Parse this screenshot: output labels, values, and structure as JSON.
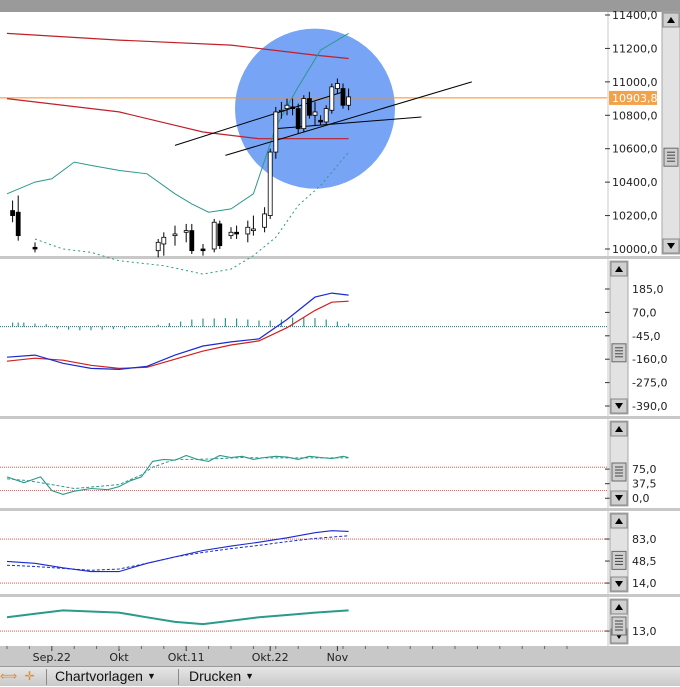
{
  "colors": {
    "price_line": "#ff8c1a",
    "price_tag": "#f4a24a",
    "ma_red": "#c0202a",
    "bollinger": "#2a9a8a",
    "highlight_circle": "#4a86f0",
    "macd_blue": "#1a2ad0",
    "signal_red": "#d02020",
    "histogram": "#2a9a8a",
    "ref_line": "#d04040",
    "dotted_teal": "#2a9a8a"
  },
  "toolbar": {
    "icons": [
      "pan-icon",
      "crosshair-icon"
    ],
    "chartvorlagen_label": "Chartvorlagen",
    "drucken_label": "Drucken",
    "dropdown_icon": "triangle-down-icon"
  },
  "chart_data": [
    {
      "type": "candlestick",
      "panel": "price",
      "y_ticks": [
        "11400,0",
        "11200,0",
        "11000,0",
        "10800,0",
        "10600,0",
        "10400,0",
        "10200,0",
        "10000,0"
      ],
      "ylim": [
        10000,
        11400
      ],
      "current_price_label": "10903,8",
      "current_price": 10903.8,
      "candles": [
        {
          "t": 1,
          "o": 10230,
          "h": 10290,
          "l": 10160,
          "c": 10200
        },
        {
          "t": 2,
          "o": 10220,
          "h": 10320,
          "l": 10050,
          "c": 10080
        },
        {
          "t": 5,
          "o": 10010,
          "h": 10040,
          "l": 9980,
          "c": 10000
        },
        {
          "t": 27,
          "o": 9990,
          "h": 10060,
          "l": 9950,
          "c": 10040
        },
        {
          "t": 28,
          "o": 10030,
          "h": 10100,
          "l": 9960,
          "c": 10070
        },
        {
          "t": 30,
          "o": 10080,
          "h": 10140,
          "l": 10020,
          "c": 10090
        },
        {
          "t": 32,
          "o": 10100,
          "h": 10150,
          "l": 10040,
          "c": 10110
        },
        {
          "t": 33,
          "o": 10110,
          "h": 10150,
          "l": 9970,
          "c": 9990
        },
        {
          "t": 35,
          "o": 10000,
          "h": 10030,
          "l": 9960,
          "c": 9990
        },
        {
          "t": 37,
          "o": 10000,
          "h": 10180,
          "l": 9980,
          "c": 10160
        },
        {
          "t": 38,
          "o": 10150,
          "h": 10170,
          "l": 10000,
          "c": 10020
        },
        {
          "t": 40,
          "o": 10080,
          "h": 10130,
          "l": 10060,
          "c": 10100
        },
        {
          "t": 41,
          "o": 10100,
          "h": 10140,
          "l": 10060,
          "c": 10090
        },
        {
          "t": 43,
          "o": 10090,
          "h": 10170,
          "l": 10040,
          "c": 10130
        },
        {
          "t": 44,
          "o": 10110,
          "h": 10200,
          "l": 10080,
          "c": 10120
        },
        {
          "t": 46,
          "o": 10130,
          "h": 10250,
          "l": 10100,
          "c": 10210
        },
        {
          "t": 47,
          "o": 10200,
          "h": 10600,
          "l": 10180,
          "c": 10580
        },
        {
          "t": 48,
          "o": 10580,
          "h": 10850,
          "l": 10540,
          "c": 10820
        },
        {
          "t": 49,
          "o": 10830,
          "h": 10880,
          "l": 10780,
          "c": 10830
        },
        {
          "t": 50,
          "o": 10840,
          "h": 10900,
          "l": 10800,
          "c": 10860
        },
        {
          "t": 51,
          "o": 10850,
          "h": 10900,
          "l": 10800,
          "c": 10840
        },
        {
          "t": 52,
          "o": 10840,
          "h": 10870,
          "l": 10690,
          "c": 10720
        },
        {
          "t": 53,
          "o": 10720,
          "h": 10920,
          "l": 10700,
          "c": 10900
        },
        {
          "t": 54,
          "o": 10900,
          "h": 10940,
          "l": 10780,
          "c": 10800
        },
        {
          "t": 55,
          "o": 10800,
          "h": 10880,
          "l": 10740,
          "c": 10820
        },
        {
          "t": 56,
          "o": 10770,
          "h": 10800,
          "l": 10740,
          "c": 10760
        },
        {
          "t": 57,
          "o": 10760,
          "h": 10860,
          "l": 10740,
          "c": 10840
        },
        {
          "t": 58,
          "o": 10830,
          "h": 10990,
          "l": 10810,
          "c": 10970
        },
        {
          "t": 59,
          "o": 10960,
          "h": 11020,
          "l": 10930,
          "c": 10990
        },
        {
          "t": 60,
          "o": 10960,
          "h": 10990,
          "l": 10840,
          "c": 10860
        },
        {
          "t": 61,
          "o": 10860,
          "h": 10960,
          "l": 10830,
          "c": 10910
        }
      ],
      "ma_red_upper": [
        [
          0,
          11290
        ],
        [
          20,
          11250
        ],
        [
          40,
          11220
        ],
        [
          55,
          11160
        ],
        [
          61,
          11140
        ]
      ],
      "ma_red_lower": [
        [
          0,
          10900
        ],
        [
          20,
          10820
        ],
        [
          35,
          10700
        ],
        [
          45,
          10660
        ],
        [
          55,
          10660
        ],
        [
          61,
          10660
        ]
      ],
      "bollinger_upper": [
        [
          0,
          10330
        ],
        [
          5,
          10400
        ],
        [
          8,
          10420
        ],
        [
          12,
          10520
        ],
        [
          15,
          10500
        ],
        [
          20,
          10470
        ],
        [
          25,
          10450
        ],
        [
          30,
          10330
        ],
        [
          33,
          10270
        ],
        [
          36,
          10220
        ],
        [
          40,
          10240
        ],
        [
          44,
          10330
        ],
        [
          48,
          10730
        ],
        [
          52,
          10970
        ],
        [
          56,
          11190
        ],
        [
          61,
          11290
        ]
      ],
      "bollinger_lower": [
        [
          5,
          10060
        ],
        [
          10,
          10000
        ],
        [
          15,
          9980
        ],
        [
          20,
          9930
        ],
        [
          28,
          9900
        ],
        [
          35,
          9850
        ],
        [
          40,
          9880
        ],
        [
          44,
          9960
        ],
        [
          48,
          10070
        ],
        [
          52,
          10260
        ],
        [
          56,
          10380
        ],
        [
          61,
          10580
        ]
      ],
      "trendlines": [
        {
          "t1": 30,
          "v1": 10620,
          "t2": 60,
          "v2": 10940
        },
        {
          "t1": 39,
          "v1": 10560,
          "t2": 83,
          "v2": 11000
        },
        {
          "t1": 48,
          "v1": 10720,
          "t2": 74,
          "v2": 10790
        }
      ],
      "highlight": {
        "t": 55,
        "v": 10840
      }
    },
    {
      "type": "line+bar",
      "panel": "macd",
      "y_ticks": [
        "185,0",
        "70,0",
        "-45,0",
        "-160,0",
        "-275,0",
        "-390,0"
      ],
      "ylim": [
        -390,
        185
      ],
      "macd": [
        [
          0,
          -150
        ],
        [
          5,
          -140
        ],
        [
          10,
          -180
        ],
        [
          15,
          -205
        ],
        [
          20,
          -210
        ],
        [
          25,
          -195
        ],
        [
          30,
          -140
        ],
        [
          35,
          -95
        ],
        [
          40,
          -75
        ],
        [
          45,
          -60
        ],
        [
          50,
          35
        ],
        [
          55,
          145
        ],
        [
          58,
          165
        ],
        [
          61,
          155
        ]
      ],
      "signal": [
        [
          0,
          -170
        ],
        [
          5,
          -155
        ],
        [
          10,
          -165
        ],
        [
          15,
          -190
        ],
        [
          20,
          -205
        ],
        [
          25,
          -200
        ],
        [
          30,
          -160
        ],
        [
          35,
          -120
        ],
        [
          40,
          -90
        ],
        [
          45,
          -70
        ],
        [
          50,
          -5
        ],
        [
          55,
          80
        ],
        [
          58,
          120
        ],
        [
          61,
          125
        ]
      ],
      "histogram": [
        [
          1,
          20
        ],
        [
          2,
          20
        ],
        [
          3,
          20
        ],
        [
          5,
          15
        ],
        [
          7,
          12
        ],
        [
          9,
          -10
        ],
        [
          11,
          -15
        ],
        [
          13,
          -18
        ],
        [
          15,
          -18
        ],
        [
          17,
          -15
        ],
        [
          19,
          -12
        ],
        [
          21,
          -10
        ],
        [
          23,
          -5
        ],
        [
          25,
          5
        ],
        [
          27,
          10
        ],
        [
          29,
          18
        ],
        [
          31,
          25
        ],
        [
          33,
          35
        ],
        [
          35,
          40
        ],
        [
          37,
          40
        ],
        [
          39,
          42
        ],
        [
          41,
          40
        ],
        [
          43,
          35
        ],
        [
          45,
          30
        ],
        [
          47,
          30
        ],
        [
          49,
          35
        ],
        [
          51,
          45
        ],
        [
          53,
          45
        ],
        [
          55,
          42
        ],
        [
          57,
          35
        ],
        [
          59,
          25
        ],
        [
          61,
          15
        ]
      ],
      "zero_line": 0
    },
    {
      "type": "line",
      "panel": "oscillator-1",
      "y_ticks": [
        "75,0",
        "37,5",
        "0,0"
      ],
      "ylim": [
        -20,
        150
      ],
      "ref_lines": [
        80,
        20
      ],
      "solid": [
        [
          0,
          55
        ],
        [
          3,
          40
        ],
        [
          6,
          55
        ],
        [
          8,
          20
        ],
        [
          10,
          10
        ],
        [
          12,
          18
        ],
        [
          15,
          25
        ],
        [
          18,
          22
        ],
        [
          20,
          30
        ],
        [
          22,
          45
        ],
        [
          24,
          55
        ],
        [
          26,
          95
        ],
        [
          28,
          100
        ],
        [
          30,
          98
        ],
        [
          32,
          110
        ],
        [
          34,
          100
        ],
        [
          36,
          95
        ],
        [
          38,
          110
        ],
        [
          40,
          105
        ],
        [
          42,
          108
        ],
        [
          44,
          100
        ],
        [
          46,
          105
        ],
        [
          48,
          108
        ],
        [
          50,
          106
        ],
        [
          52,
          100
        ],
        [
          54,
          108
        ],
        [
          56,
          105
        ],
        [
          58,
          102
        ],
        [
          60,
          108
        ],
        [
          61,
          105
        ]
      ],
      "dashed": [
        [
          0,
          50
        ],
        [
          4,
          45
        ],
        [
          8,
          35
        ],
        [
          12,
          25
        ],
        [
          16,
          30
        ],
        [
          20,
          35
        ],
        [
          24,
          60
        ],
        [
          26,
          80
        ],
        [
          30,
          100
        ],
        [
          34,
          100
        ],
        [
          38,
          102
        ],
        [
          42,
          105
        ],
        [
          46,
          104
        ],
        [
          50,
          104
        ],
        [
          54,
          104
        ],
        [
          58,
          104
        ],
        [
          61,
          104
        ]
      ]
    },
    {
      "type": "line",
      "panel": "oscillator-2",
      "y_ticks": [
        "83,0",
        "48,5",
        "14,0"
      ],
      "ylim": [
        0,
        105
      ],
      "ref_lines": [
        83,
        14
      ],
      "solid": [
        [
          0,
          48
        ],
        [
          5,
          45
        ],
        [
          10,
          38
        ],
        [
          15,
          32
        ],
        [
          20,
          32
        ],
        [
          25,
          45
        ],
        [
          30,
          55
        ],
        [
          35,
          65
        ],
        [
          40,
          72
        ],
        [
          45,
          78
        ],
        [
          50,
          85
        ],
        [
          55,
          93
        ],
        [
          58,
          96
        ],
        [
          61,
          95
        ]
      ],
      "dashed": [
        [
          0,
          42
        ],
        [
          5,
          40
        ],
        [
          10,
          37
        ],
        [
          15,
          34
        ],
        [
          20,
          36
        ],
        [
          25,
          45
        ],
        [
          30,
          55
        ],
        [
          35,
          62
        ],
        [
          40,
          68
        ],
        [
          45,
          73
        ],
        [
          50,
          79
        ],
        [
          55,
          84
        ],
        [
          58,
          86
        ],
        [
          61,
          88
        ]
      ]
    },
    {
      "type": "line",
      "panel": "oscillator-3",
      "y_ticks": [
        "13,0"
      ],
      "ylim": [
        0,
        40
      ],
      "ref_lines": [
        13
      ],
      "solid": [
        [
          0,
          25
        ],
        [
          5,
          28
        ],
        [
          10,
          31
        ],
        [
          15,
          30
        ],
        [
          20,
          29
        ],
        [
          25,
          25
        ],
        [
          30,
          21
        ],
        [
          35,
          19
        ],
        [
          40,
          22
        ],
        [
          45,
          25
        ],
        [
          50,
          27
        ],
        [
          55,
          29
        ],
        [
          61,
          31
        ]
      ]
    }
  ],
  "x_axis": {
    "labels": [
      {
        "t": 8,
        "text": "Sep.22"
      },
      {
        "t": 20,
        "text": "Okt"
      },
      {
        "t": 32,
        "text": "Okt.11"
      },
      {
        "t": 47,
        "text": "Okt.22"
      },
      {
        "t": 59,
        "text": "Nov"
      }
    ]
  }
}
